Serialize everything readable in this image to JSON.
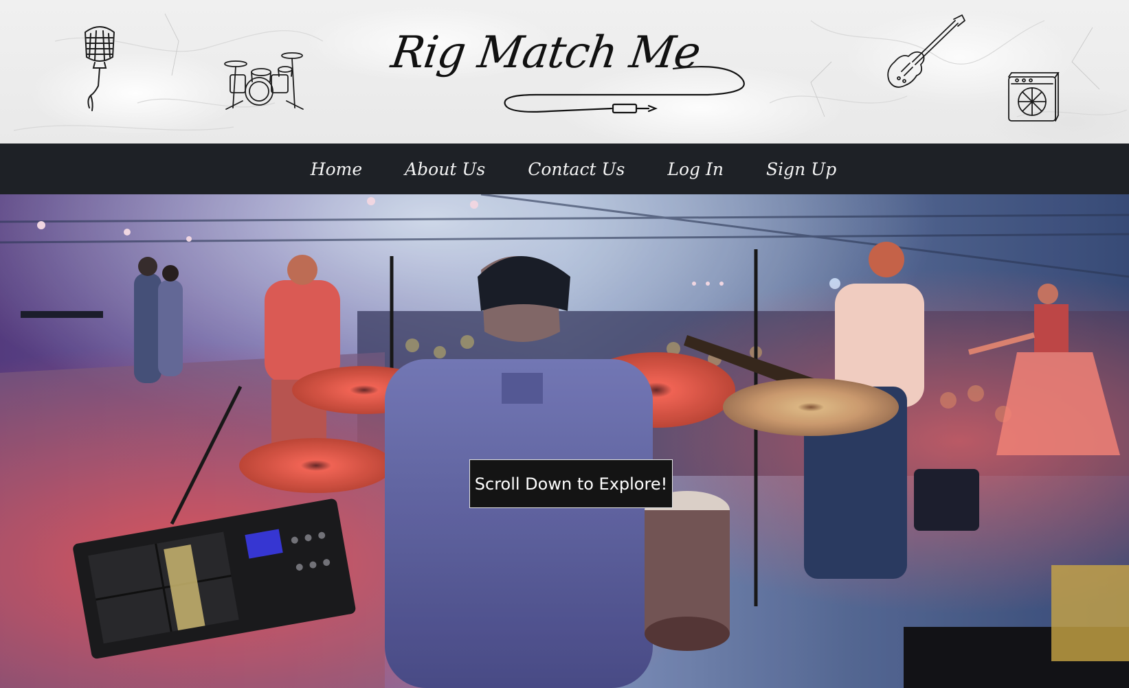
{
  "header": {
    "logo_text": "Rig Match Me",
    "icons": [
      "microphone-icon",
      "drum-kit-icon",
      "electric-guitar-icon",
      "amplifier-icon"
    ]
  },
  "nav": {
    "items": [
      {
        "label": "Home"
      },
      {
        "label": "About Us"
      },
      {
        "label": "Contact Us"
      },
      {
        "label": "Log In"
      },
      {
        "label": "Sign Up"
      }
    ]
  },
  "hero": {
    "cta_label": "Scroll Down to Explore!"
  },
  "colors": {
    "nav_background": "#1e2126",
    "header_background": "#eeeeee",
    "cta_background": "#141414",
    "text_light": "#f5f5f5"
  }
}
